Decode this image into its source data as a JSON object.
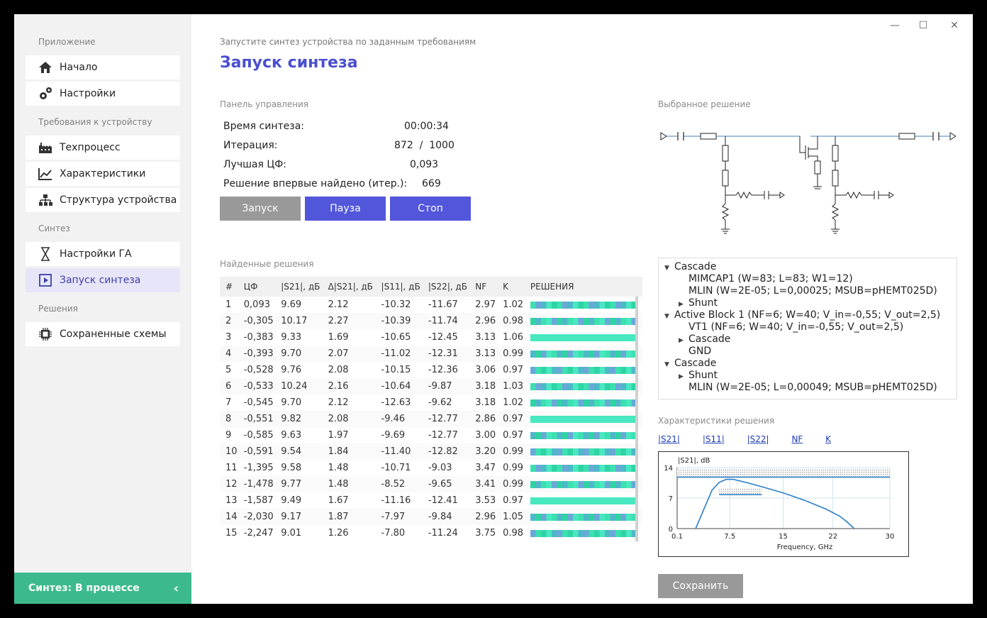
{
  "sidebar": {
    "sections": [
      "Приложение",
      "Требования к устройству",
      "Синтез",
      "Решения"
    ],
    "items": [
      {
        "label": "Начало",
        "icon": "home-icon"
      },
      {
        "label": "Настройки",
        "icon": "gears-icon"
      },
      {
        "label": "Техпроцесс",
        "icon": "factory-icon"
      },
      {
        "label": "Характеристики",
        "icon": "line-chart-icon"
      },
      {
        "label": "Структура устройства",
        "icon": "hierarchy-icon"
      },
      {
        "label": "Настройки ГА",
        "icon": "hourglass-icon"
      },
      {
        "label": "Запуск синтеза",
        "icon": "play-square-icon"
      },
      {
        "label": "Сохраненные схемы",
        "icon": "chip-icon"
      }
    ],
    "status": "Синтез: В процессе",
    "status_chevron": "‹"
  },
  "header": {
    "subtitle": "Запустите синтез устройства по заданным требованиям",
    "title": "Запуск синтеза"
  },
  "window_controls": {
    "minimize": "—",
    "maximize": "☐",
    "close": "✕"
  },
  "control_panel": {
    "label": "Панель управления",
    "rows": [
      {
        "key": "Время синтеза:",
        "value": "00:00:34"
      },
      {
        "key": "Итерация:",
        "value": "872  /  1000"
      },
      {
        "key": "Лучшая ЦФ:",
        "value": "0,093"
      },
      {
        "key": "Решение впервые найдено (итер.):",
        "value": "669"
      }
    ],
    "buttons": {
      "start": "Запуск",
      "pause": "Пауза",
      "stop": "Стоп"
    }
  },
  "solutions": {
    "label": "Найденные решения",
    "columns": [
      "#",
      "ЦФ",
      "|S21|, дБ",
      "Δ|S21|, дБ",
      "|S11|, дБ",
      "|S22|, дБ",
      "NF",
      "K",
      "РЕШЕНИЯ"
    ],
    "rows": [
      [
        "1",
        "0,093",
        "9.69",
        "2.12",
        "-10.32",
        "-11.67",
        "2.97",
        "1.02"
      ],
      [
        "2",
        "-0,305",
        "10.17",
        "2.27",
        "-10.39",
        "-11.74",
        "2.96",
        "0.98"
      ],
      [
        "3",
        "-0,383",
        "9.33",
        "1.69",
        "-10.65",
        "-12.45",
        "3.13",
        "1.06"
      ],
      [
        "4",
        "-0,393",
        "9.70",
        "2.07",
        "-11.02",
        "-12.31",
        "3.13",
        "0.99"
      ],
      [
        "5",
        "-0,528",
        "9.76",
        "2.08",
        "-10.15",
        "-12.36",
        "3.06",
        "0.97"
      ],
      [
        "6",
        "-0,533",
        "10.24",
        "2.16",
        "-10.64",
        "-9.87",
        "3.18",
        "1.03"
      ],
      [
        "7",
        "-0,545",
        "9.70",
        "2.12",
        "-12.63",
        "-9.62",
        "3.18",
        "1.02"
      ],
      [
        "8",
        "-0,551",
        "9.82",
        "2.08",
        "-9.46",
        "-12.77",
        "2.86",
        "0.97"
      ],
      [
        "9",
        "-0,585",
        "9.63",
        "1.97",
        "-9.69",
        "-12.77",
        "3.00",
        "0.97"
      ],
      [
        "10",
        "-0,591",
        "9.54",
        "1.84",
        "-11.40",
        "-12.82",
        "3.20",
        "0.99"
      ],
      [
        "11",
        "-1,395",
        "9.58",
        "1.48",
        "-10.71",
        "-9.03",
        "3.47",
        "0.99"
      ],
      [
        "12",
        "-1,478",
        "9.77",
        "1.48",
        "-8.52",
        "-9.65",
        "3.41",
        "0.99"
      ],
      [
        "13",
        "-1,587",
        "9.49",
        "1.67",
        "-11.16",
        "-12.41",
        "3.53",
        "0.97"
      ],
      [
        "14",
        "-2,030",
        "9.17",
        "1.87",
        "-7.97",
        "-9.84",
        "2.96",
        "1.05"
      ],
      [
        "15",
        "-2,247",
        "9.01",
        "1.26",
        "-7.80",
        "-11.24",
        "3.75",
        "0.98"
      ]
    ],
    "bar_colors": [
      "#3de0b0",
      "#4fb8c8",
      "#2fd4a4",
      "#6aa8d8",
      "#48e8c0"
    ]
  },
  "selected": {
    "label": "Выбранное решение",
    "tree": [
      {
        "level": 0,
        "arrow": "down",
        "text": "Cascade"
      },
      {
        "level": 1,
        "arrow": "none",
        "text": "MIMCAP1 (W=83; L=83; W1=12)"
      },
      {
        "level": 1,
        "arrow": "none",
        "text": "MLIN (W=2E-05; L=0,00025; MSUB=pHEMT025D)"
      },
      {
        "level": 1,
        "arrow": "right",
        "text": "Shunt"
      },
      {
        "level": 0,
        "arrow": "down",
        "text": "Active Block 1 (NF=6; W=40; V_in=-0,55; V_out=2,5)"
      },
      {
        "level": 1,
        "arrow": "none",
        "text": "VT1 (NF=6; W=40; V_in=-0,55; V_out=2,5)"
      },
      {
        "level": 1,
        "arrow": "right",
        "text": "Cascade"
      },
      {
        "level": 1,
        "arrow": "none",
        "text": "GND"
      },
      {
        "level": 0,
        "arrow": "down",
        "text": "Cascade"
      },
      {
        "level": 1,
        "arrow": "right",
        "text": "Shunt"
      },
      {
        "level": 1,
        "arrow": "none",
        "text": "MLIN (W=2E-05; L=0,00049; MSUB=pHEMT025D)"
      }
    ]
  },
  "characteristics": {
    "label": "Характеристики решения",
    "tabs": [
      "|S21|",
      "|S11|",
      "|S22|",
      "NF",
      "K"
    ],
    "save": "Сохранить"
  },
  "chart_data": {
    "type": "line",
    "ylabel": "|S21|, dB",
    "xlabel": "Frequency, GHz",
    "xticks": [
      "0.1",
      "7.5",
      "15",
      "22",
      "30"
    ],
    "yticks": [
      "0",
      "7",
      "14"
    ],
    "xlim": [
      0.1,
      30
    ],
    "ylim": [
      0,
      14
    ],
    "x": [
      2.7,
      4,
      5,
      6,
      7,
      8,
      10,
      12,
      15,
      18,
      21,
      23,
      24,
      25
    ],
    "y": [
      0,
      5,
      8.8,
      10.6,
      11.3,
      11.3,
      10.5,
      9.6,
      8.2,
      6.5,
      4.5,
      2.8,
      1.5,
      0
    ],
    "color": "#2b7fc8",
    "bands": [
      {
        "x0": 0.1,
        "x1": 30,
        "y0": 11.8,
        "y1": 13.8
      },
      {
        "x0": 6,
        "x1": 12,
        "y0": 7.8,
        "y1": 9.2
      }
    ],
    "bands_color": "#9a9a9a"
  }
}
